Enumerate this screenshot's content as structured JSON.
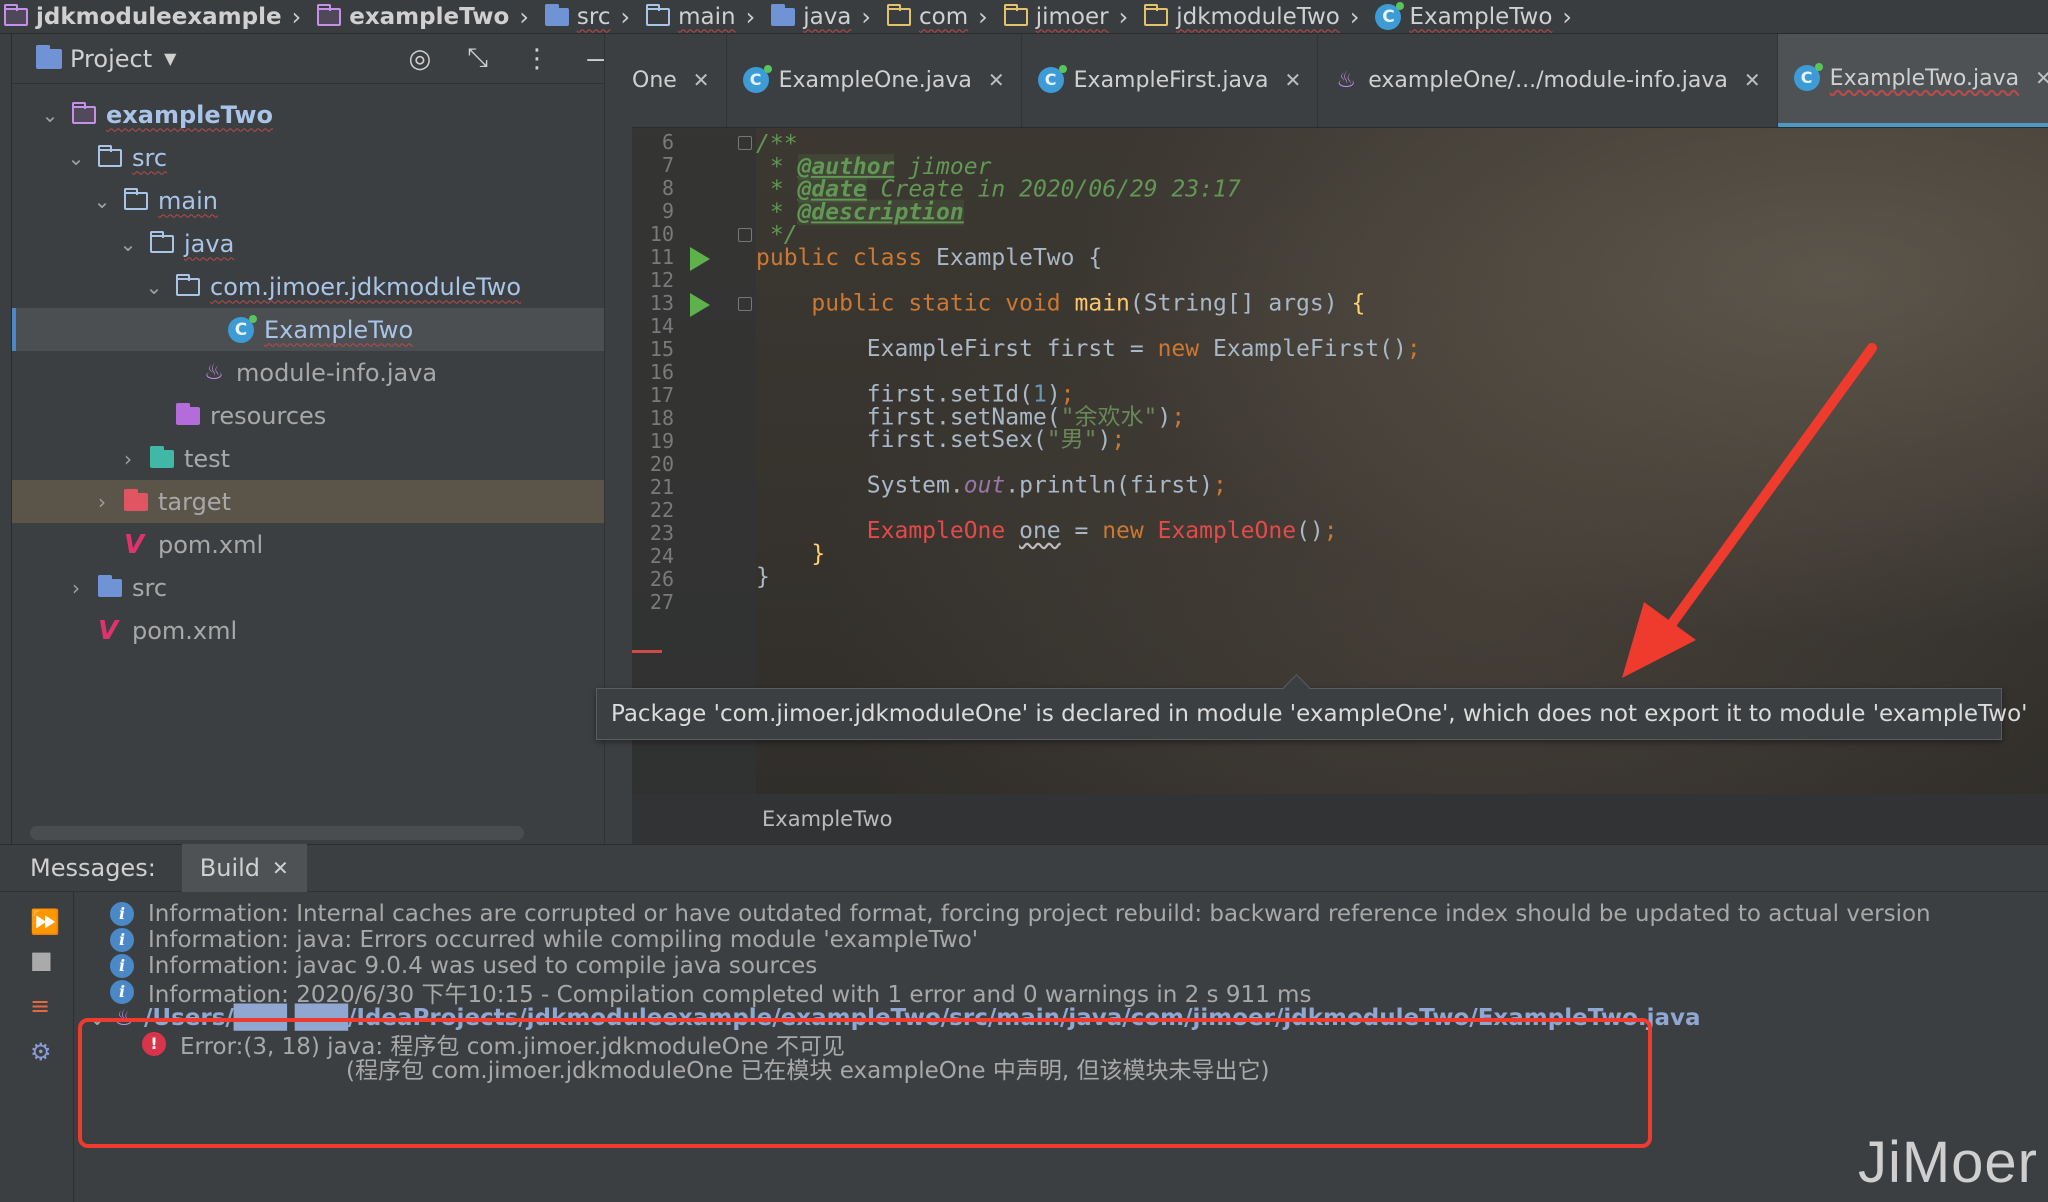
{
  "breadcrumb": [
    {
      "label": "jdkmoduleexample",
      "icon": "module-icon",
      "bold": true
    },
    {
      "label": "exampleTwo",
      "icon": "module-folder-icon",
      "bold": true
    },
    {
      "label": "src",
      "icon": "source-folder-icon"
    },
    {
      "label": "main",
      "icon": "folder-icon"
    },
    {
      "label": "java",
      "icon": "source-root-icon"
    },
    {
      "label": "com",
      "icon": "package-icon"
    },
    {
      "label": "jimoer",
      "icon": "package-icon"
    },
    {
      "label": "jdkmoduleTwo",
      "icon": "package-icon"
    },
    {
      "label": "ExampleTwo",
      "icon": "class-icon"
    }
  ],
  "project": {
    "title": "Project",
    "tree": [
      {
        "label": "exampleTwo",
        "indent": 0,
        "arrow": "down",
        "icon": "module-folder",
        "bold": true,
        "wavy": true
      },
      {
        "label": "src",
        "indent": 1,
        "arrow": "down",
        "icon": "folder",
        "wavy": true
      },
      {
        "label": "main",
        "indent": 2,
        "arrow": "down",
        "icon": "folder",
        "wavy": true
      },
      {
        "label": "java",
        "indent": 3,
        "arrow": "down",
        "icon": "source-root",
        "wavy": true
      },
      {
        "label": "com.jimoer.jdkmoduleTwo",
        "indent": 4,
        "arrow": "down",
        "icon": "package",
        "wavy": true
      },
      {
        "label": "ExampleTwo",
        "indent": 6,
        "arrow": "",
        "icon": "class",
        "wavy": true,
        "selected": true
      },
      {
        "label": "module-info.java",
        "indent": 5,
        "arrow": "",
        "icon": "java"
      },
      {
        "label": "resources",
        "indent": 4,
        "arrow": "",
        "icon": "resources"
      },
      {
        "label": "test",
        "indent": 3,
        "arrow": "right",
        "icon": "test"
      },
      {
        "label": "target",
        "indent": 2,
        "arrow": "right",
        "icon": "target",
        "target": true
      },
      {
        "label": "pom.xml",
        "indent": 2,
        "arrow": "",
        "icon": "maven"
      },
      {
        "label": "src",
        "indent": 1,
        "arrow": "right",
        "icon": "src-module"
      },
      {
        "label": "pom.xml",
        "indent": 1,
        "arrow": "",
        "icon": "maven"
      }
    ]
  },
  "tabs": [
    {
      "label": "One",
      "icon": "",
      "partial": true
    },
    {
      "label": "ExampleOne.java",
      "icon": "class"
    },
    {
      "label": "ExampleFirst.java",
      "icon": "class"
    },
    {
      "label": "exampleOne/.../module-info.java",
      "icon": "java"
    },
    {
      "label": "ExampleTwo.java",
      "icon": "class",
      "active": true
    }
  ],
  "code": {
    "line_numbers": [
      "6",
      "7",
      "8",
      "9",
      "10",
      "11",
      "12",
      "13",
      "14",
      "15",
      "16",
      "17",
      "18",
      "19",
      "20",
      "21",
      "22",
      "23",
      "24",
      "26",
      "27"
    ],
    "lines": [
      [
        [
          "cm",
          "/**"
        ]
      ],
      [
        [
          "cm",
          " * "
        ],
        [
          "tag",
          "@author"
        ],
        [
          "cm",
          " jimoer"
        ]
      ],
      [
        [
          "cm",
          " * "
        ],
        [
          "tag",
          "@date"
        ],
        [
          "cm",
          " Create in 2020/06/29 23:17"
        ]
      ],
      [
        [
          "cm",
          " * "
        ],
        [
          "tag",
          "@description"
        ]
      ],
      [
        [
          "cm",
          " */"
        ]
      ],
      [
        [
          "kw",
          "public class "
        ],
        [
          "id",
          "ExampleTwo {"
        ]
      ],
      [],
      [
        [
          "kw",
          "    public static void "
        ],
        [
          "fn",
          "main"
        ],
        [
          "id",
          "(String[] args) "
        ],
        [
          "paren",
          "{"
        ]
      ],
      [],
      [
        [
          "id",
          "        ExampleFirst first = "
        ],
        [
          "kw",
          "new "
        ],
        [
          "id",
          "ExampleFirst()"
        ],
        [
          "kw",
          ";"
        ]
      ],
      [],
      [
        [
          "id",
          "        first.setId("
        ],
        [
          "num",
          "1"
        ],
        [
          "id",
          ")"
        ],
        [
          "kw",
          ";"
        ]
      ],
      [
        [
          "id",
          "        first.setName("
        ],
        [
          "str",
          "\"余欢水\""
        ],
        [
          "id",
          ")"
        ],
        [
          "kw",
          ";"
        ]
      ],
      [
        [
          "id",
          "        first.setSex("
        ],
        [
          "str",
          "\"男\""
        ],
        [
          "id",
          ")"
        ],
        [
          "kw",
          ";"
        ]
      ],
      [],
      [
        [
          "id",
          "        System."
        ],
        [
          "field",
          "out"
        ],
        [
          "id",
          ".println(first)"
        ],
        [
          "kw",
          ";"
        ]
      ],
      [],
      [
        [
          "err",
          "        ExampleOne "
        ],
        [
          "wavy",
          "one"
        ],
        [
          "id",
          " = "
        ],
        [
          "kw",
          "new "
        ],
        [
          "err",
          "ExampleOne"
        ],
        [
          "id",
          "()"
        ],
        [
          "kw",
          ";"
        ]
      ],
      [
        [
          "paren",
          "    }"
        ]
      ],
      [
        [
          "id",
          "}"
        ]
      ],
      []
    ],
    "footer_crumb": "ExampleTwo"
  },
  "tooltip": "Package 'com.jimoer.jdkmoduleOne' is declared in module 'exampleOne', which does not export it to module 'exampleTwo'",
  "messages": {
    "label": "Messages:",
    "tab": "Build",
    "rows": [
      {
        "type": "info",
        "text": "Information: Internal caches are corrupted or have outdated format, forcing project rebuild: backward reference index should be updated to actual version"
      },
      {
        "type": "info",
        "text": "Information: java: Errors occurred while compiling module 'exampleTwo'"
      },
      {
        "type": "info",
        "text": "Information: javac 9.0.4 was used to compile java sources"
      },
      {
        "type": "info",
        "text": "Information: 2020/6/30 下午10:15 - Compilation completed with 1 error and 0 warnings in 2 s 911 ms"
      },
      {
        "type": "path",
        "text": "/Users/███ ███/IdeaProjects/jdkmoduleexample/exampleTwo/src/main/java/com/jimoer/jdkmoduleTwo/ExampleTwo.java"
      },
      {
        "type": "error",
        "text": "Error:(3, 18)  java: 程序包 com.jimoer.jdkmoduleOne 不可见"
      },
      {
        "type": "detail",
        "text": "(程序包 com.jimoer.jdkmoduleOne 已在模块 exampleOne 中声明, 但该模块未导出它)"
      }
    ]
  },
  "watermark": "JiMoer",
  "colors": {
    "accent": "#4a9ac4",
    "error": "#ef3b2d",
    "run": "#5fb14b"
  }
}
